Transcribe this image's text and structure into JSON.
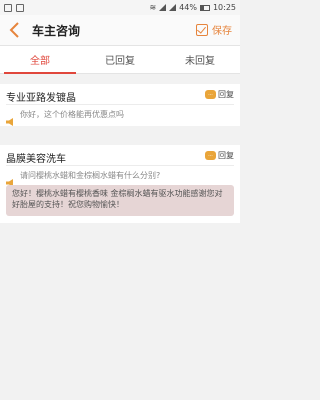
{
  "status_bar": {
    "battery": "44%",
    "time": "10:25"
  },
  "header": {
    "title": "车主咨询",
    "save_label": "保存"
  },
  "tabs": [
    {
      "label": "全部",
      "active": true
    },
    {
      "label": "已回复",
      "active": false
    },
    {
      "label": "未回复",
      "active": false
    }
  ],
  "consultations": [
    {
      "shop": "专业亚路发镀晶",
      "reply_label": "回复",
      "question": "你好，这个价格能再优惠点吗",
      "reply": ""
    },
    {
      "shop": "晶膜美容洗车",
      "reply_label": "回复",
      "question": "请问樱桃水蜡和金棕榈水蜡有什么分别?",
      "reply": "您好！樱桃水蜡有樱桃香味 金棕榈水蜡有驱水功能感谢您对好胎屋的支持！祝您购物愉快！"
    }
  ],
  "colors": {
    "accent": "#e0473c",
    "save": "#e6843c",
    "reply_badge": "#e9a53a",
    "reply_bg": "#e6d5d5"
  }
}
